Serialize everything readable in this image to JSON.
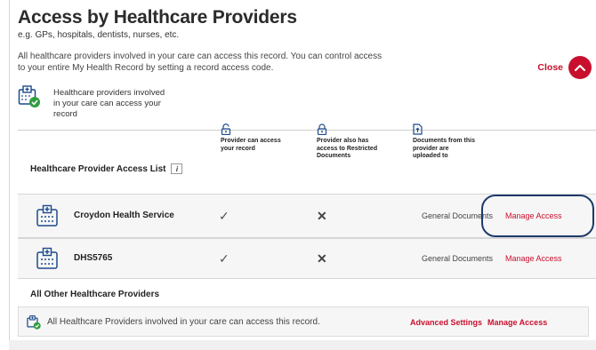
{
  "page": {
    "title": "Access by Healthcare Providers",
    "subtitle": "e.g. GPs, hospitals, dentists, nurses, etc.",
    "intro": "All healthcare providers involved in your care can access this record. You can control access to your entire My Health Record by setting a record access code.",
    "close_label": "Close"
  },
  "summary": {
    "text": "Healthcare providers involved in your care can access your record"
  },
  "access_list": {
    "title": "Healthcare Provider Access List",
    "columns": [
      {
        "label": "Provider can access your record",
        "icon": "unlock-icon"
      },
      {
        "label": "Provider also has access to Restricted Documents",
        "icon": "lock-icon"
      },
      {
        "label": "Documents from this provider are uploaded to",
        "icon": "upload-document-icon"
      }
    ],
    "rows": [
      {
        "name": "Croydon Health Service",
        "can_access": "✓",
        "restricted": "✕",
        "documents": "General Documents",
        "action": "Manage Access"
      },
      {
        "name": "DHS5765",
        "can_access": "✓",
        "restricted": "✕",
        "documents": "General Documents",
        "action": "Manage Access"
      }
    ]
  },
  "other_providers": {
    "title": "All Other Healthcare Providers",
    "text": "All Healthcare Providers involved in your care can access this record.",
    "advanced_label": "Advanced Settings",
    "manage_label": "Manage Access"
  },
  "colors": {
    "accent": "#c8102e",
    "highlight": "#1e3a6b",
    "icon_blue": "#1c4a8c",
    "icon_green": "#2e9e3f"
  }
}
